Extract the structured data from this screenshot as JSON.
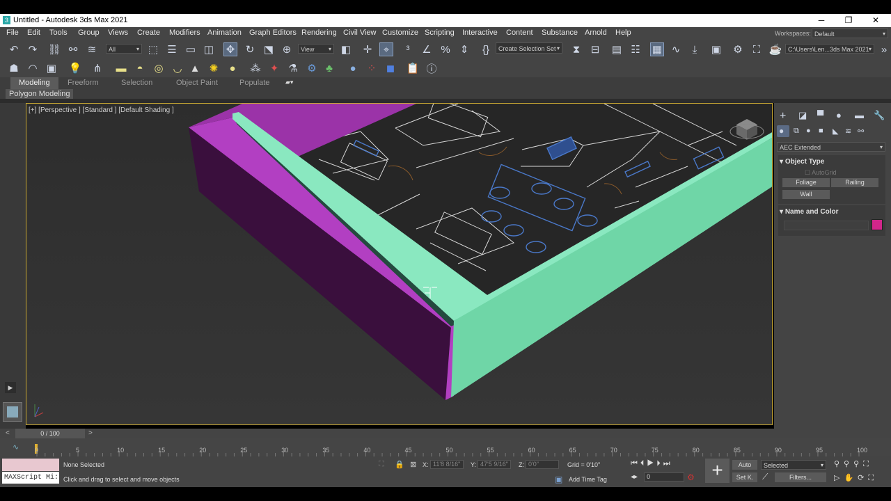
{
  "window": {
    "title": "Untitled - Autodesk 3ds Max 2021",
    "app_icon": "3",
    "minimize": "─",
    "maximize": "❐",
    "close": "✕"
  },
  "menu": [
    "File",
    "Edit",
    "Tools",
    "Group",
    "Views",
    "Create",
    "Modifiers",
    "Animation",
    "Graph Editors",
    "Rendering",
    "Civil View",
    "Customize",
    "Scripting",
    "Interactive",
    "Content",
    "Substance",
    "Arnold",
    "Help"
  ],
  "workspaces": {
    "label": "Workspaces:",
    "value": "Default"
  },
  "toolbar": {
    "selection_filter": "All",
    "ref_coord": "View",
    "selection_set": "Create Selection Set",
    "project_path": "C:\\Users\\Len...3ds Max 2021"
  },
  "ribbon": {
    "tabs": [
      "Modeling",
      "Freeform",
      "Selection",
      "Object Paint",
      "Populate"
    ],
    "active_tab": "Modeling",
    "panel_label": "Polygon Modeling"
  },
  "viewport": {
    "label": "[+] [Perspective ] [Standard ] [Default Shading ]"
  },
  "command_panel": {
    "category": "AEC Extended",
    "object_type_header": "Object Type",
    "autogrid": "AutoGrid",
    "buttons": [
      "Foliage",
      "Railing",
      "Wall"
    ],
    "name_color_header": "Name and Color",
    "object_color": "#d1268a"
  },
  "timeline": {
    "frame_display": "0 / 100",
    "prev": "<",
    "next": ">",
    "ticks": [
      "0",
      "5",
      "10",
      "15",
      "20",
      "25",
      "30",
      "35",
      "40",
      "45",
      "50",
      "55",
      "60",
      "65",
      "70",
      "75",
      "80",
      "85",
      "90",
      "95",
      "100"
    ]
  },
  "status": {
    "maxscript": "MAXScript Mi:",
    "selection": "None Selected",
    "prompt": "Click and drag to select and move objects",
    "x_label": "X:",
    "x_value": "11'8 8/16\"",
    "y_label": "Y:",
    "y_value": "47'5 9/16\"",
    "z_label": "Z:",
    "z_value": "0'0\"",
    "grid": "Grid = 0'10\"",
    "add_time_tag": "Add Time Tag",
    "auto": "Auto",
    "selected": "Selected",
    "set_key": "Set K.",
    "filters": "Filters...",
    "frame_value": "0"
  },
  "colors": {
    "wall_left": "#3a0f3d",
    "wall_left_top": "#b23fc2",
    "wall_right": "#6fd6a7",
    "wall_inner": "#244a3f",
    "floor": "#272727",
    "plan_lines": "#d8d8d8",
    "plan_blue": "#4a78c8"
  }
}
